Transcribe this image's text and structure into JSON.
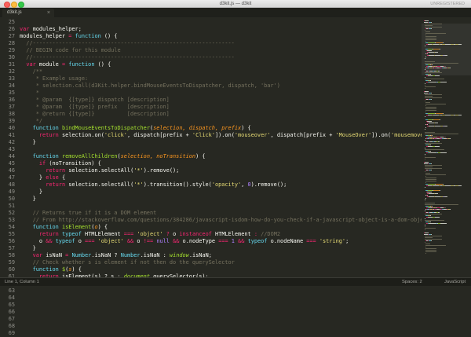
{
  "window": {
    "title": "d3kit.js — d3kit",
    "unregistered": "UNREGISTERED"
  },
  "tabs": [
    {
      "label": "d3kit.js",
      "close": "×"
    }
  ],
  "colors": {
    "background": "#272822",
    "keyword": "#f92672",
    "storage": "#66d9ef",
    "function_name": "#a6e22e",
    "string": "#e6db74",
    "comment": "#75715e",
    "number": "#ae81ff",
    "parameter": "#fd971f"
  },
  "line_numbers": [
    "25",
    "26",
    "27",
    "28",
    "29",
    "30",
    "31",
    "32",
    "33",
    "34",
    "35",
    "36",
    "37",
    "38",
    "39",
    "40",
    "41",
    "42",
    "43",
    "44",
    "45",
    "46",
    "47",
    "48",
    "49",
    "50",
    "51",
    "52",
    "53",
    "54",
    "55",
    "56",
    "57",
    "58",
    "59",
    "60",
    "61",
    "62",
    "63",
    "64",
    "65",
    "66",
    "67",
    "68",
    "69"
  ],
  "code_lines": [
    [],
    [
      [
        "var ",
        "k"
      ],
      [
        "modules_helper;",
        "t"
      ]
    ],
    [
      [
        "modules_helper ",
        "t"
      ],
      [
        "= ",
        "k"
      ],
      [
        "function ",
        "s"
      ],
      [
        "() {",
        "t"
      ]
    ],
    [
      [
        "  //--------------------------------------------------------------",
        "c"
      ]
    ],
    [
      [
        "  // BEGIN code for this module",
        "c"
      ]
    ],
    [
      [
        "  //--------------------------------------------------------------",
        "c"
      ]
    ],
    [
      [
        "  ",
        "t"
      ],
      [
        "var ",
        "k"
      ],
      [
        "module ",
        "t"
      ],
      [
        "= ",
        "k"
      ],
      [
        "function ",
        "s"
      ],
      [
        "() {",
        "t"
      ]
    ],
    [
      [
        "    /**",
        "c"
      ]
    ],
    [
      [
        "     * Example usage:",
        "c"
      ]
    ],
    [
      [
        "     * selection.call(d3Kit.helper.bindMouseEventsToDispatcher, dispatch, 'bar')",
        "c"
      ]
    ],
    [
      [
        "     *",
        "c"
      ]
    ],
    [
      [
        "     * @param  {[type]} dispatch [description]",
        "c"
      ]
    ],
    [
      [
        "     * @param  {[type]} prefix   [description]",
        "c"
      ]
    ],
    [
      [
        "     * @return {[type]}          [description]",
        "c"
      ]
    ],
    [
      [
        "     */",
        "c"
      ]
    ],
    [
      [
        "    ",
        "t"
      ],
      [
        "function ",
        "s"
      ],
      [
        "bindMouseEventsToDispatcher",
        "f"
      ],
      [
        "(",
        "t"
      ],
      [
        "selection, dispatch, prefix",
        "p"
      ],
      [
        ") {",
        "t"
      ]
    ],
    [
      [
        "      ",
        "t"
      ],
      [
        "return ",
        "k"
      ],
      [
        "selection.on(",
        "t"
      ],
      [
        "'click'",
        "q"
      ],
      [
        ", dispatch[prefix + ",
        "t"
      ],
      [
        "'Click'",
        "q"
      ],
      [
        "]).on(",
        "t"
      ],
      [
        "'mouseover'",
        "q"
      ],
      [
        ", dispatch[prefix + ",
        "t"
      ],
      [
        "'MouseOver'",
        "q"
      ],
      [
        "]).on(",
        "t"
      ],
      [
        "'mousemove'",
        "q"
      ],
      [
        ", dispatch[",
        "t"
      ]
    ],
    [
      [
        "    }",
        "t"
      ]
    ],
    [],
    [
      [
        "    ",
        "t"
      ],
      [
        "function ",
        "s"
      ],
      [
        "removeAllChildren",
        "f"
      ],
      [
        "(",
        "t"
      ],
      [
        "selection, noTransition",
        "p"
      ],
      [
        ") {",
        "t"
      ]
    ],
    [
      [
        "      ",
        "t"
      ],
      [
        "if ",
        "k"
      ],
      [
        "(noTransition) {",
        "t"
      ]
    ],
    [
      [
        "        ",
        "t"
      ],
      [
        "return ",
        "k"
      ],
      [
        "selection.selectAll(",
        "t"
      ],
      [
        "'*'",
        "q"
      ],
      [
        ").remove();",
        "t"
      ]
    ],
    [
      [
        "      } ",
        "t"
      ],
      [
        "else ",
        "k"
      ],
      [
        "{",
        "t"
      ]
    ],
    [
      [
        "        ",
        "t"
      ],
      [
        "return ",
        "k"
      ],
      [
        "selection.selectAll(",
        "t"
      ],
      [
        "'*'",
        "q"
      ],
      [
        ").transition().style(",
        "t"
      ],
      [
        "'opacity'",
        "q"
      ],
      [
        ", ",
        "t"
      ],
      [
        "0",
        "n"
      ],
      [
        ").remove();",
        "t"
      ]
    ],
    [
      [
        "      }",
        "t"
      ]
    ],
    [
      [
        "    }",
        "t"
      ]
    ],
    [],
    [
      [
        "    // Returns true if it is a DOM element",
        "c"
      ]
    ],
    [
      [
        "    // From http://stackoverflow.com/questions/384286/javascript-isdom-how-do-you-check-if-a-javascript-object-is-a-dom-object",
        "c"
      ]
    ],
    [
      [
        "    ",
        "t"
      ],
      [
        "function ",
        "s"
      ],
      [
        "isElement",
        "f"
      ],
      [
        "(",
        "t"
      ],
      [
        "o",
        "p"
      ],
      [
        ") {",
        "t"
      ]
    ],
    [
      [
        "      ",
        "t"
      ],
      [
        "return ",
        "k"
      ],
      [
        "typeof ",
        "s"
      ],
      [
        "HTMLElement ",
        "t"
      ],
      [
        "=== ",
        "k"
      ],
      [
        "'object' ",
        "q"
      ],
      [
        "? ",
        "k"
      ],
      [
        "o ",
        "t"
      ],
      [
        "instanceof ",
        "k"
      ],
      [
        "HTMLElement ",
        "t"
      ],
      [
        ": ",
        "k"
      ],
      [
        "//DOM2",
        "c"
      ]
    ],
    [
      [
        "      o ",
        "t"
      ],
      [
        "&& ",
        "k"
      ],
      [
        "typeof ",
        "s"
      ],
      [
        "o ",
        "t"
      ],
      [
        "=== ",
        "k"
      ],
      [
        "'object' ",
        "q"
      ],
      [
        "&& ",
        "k"
      ],
      [
        "o ",
        "t"
      ],
      [
        "!== ",
        "k"
      ],
      [
        "null ",
        "n"
      ],
      [
        "&& ",
        "k"
      ],
      [
        "o.nodeType ",
        "t"
      ],
      [
        "=== ",
        "k"
      ],
      [
        "1 ",
        "n"
      ],
      [
        "&& ",
        "k"
      ],
      [
        "typeof ",
        "s"
      ],
      [
        "o.nodeName ",
        "t"
      ],
      [
        "=== ",
        "k"
      ],
      [
        "'string'",
        "q"
      ],
      [
        ";",
        "t"
      ]
    ],
    [
      [
        "    }",
        "t"
      ]
    ],
    [
      [
        "    ",
        "t"
      ],
      [
        "var ",
        "k"
      ],
      [
        "isNaN ",
        "t"
      ],
      [
        "= ",
        "k"
      ],
      [
        "Number",
        "s"
      ],
      [
        ".isNaN ? ",
        "t"
      ],
      [
        "Number",
        "s"
      ],
      [
        ".isNaN : ",
        "t"
      ],
      [
        "window",
        "o"
      ],
      [
        ".isNaN;",
        "t"
      ]
    ],
    [
      [
        "    // Check whether s is element if not then do the querySelector",
        "c"
      ]
    ],
    [
      [
        "    ",
        "t"
      ],
      [
        "function ",
        "s"
      ],
      [
        "$",
        "f"
      ],
      [
        "(",
        "t"
      ],
      [
        "s",
        "p"
      ],
      [
        ") {",
        "t"
      ]
    ],
    [
      [
        "      ",
        "t"
      ],
      [
        "return ",
        "k"
      ],
      [
        "isElement(s) ? s : ",
        "t"
      ],
      [
        "document",
        "o"
      ],
      [
        ".querySelector(s);",
        "t"
      ]
    ],
    [
      [
        "    }",
        "t"
      ]
    ],
    [
      [
        "    // To get a proper array from a NodeList that matches the CSS selector",
        "c"
      ]
    ],
    [
      [
        "    ",
        "t"
      ],
      [
        "function ",
        "s"
      ],
      [
        "$$",
        "f"
      ],
      [
        "(",
        "t"
      ],
      [
        "s",
        "p"
      ],
      [
        ") {",
        "t"
      ]
    ],
    [
      [
        "      ",
        "t"
      ],
      [
        "return ",
        "k"
      ],
      [
        "Array",
        "s"
      ],
      [
        ".isArray(s) ? s : [].slice.",
        "t"
      ],
      [
        "call",
        "s"
      ],
      [
        "(",
        "t"
      ],
      [
        "document",
        "o"
      ],
      [
        ".querySelectorAll(s));",
        "t"
      ]
    ],
    [
      [
        "    }",
        "t"
      ]
    ],
    [
      [
        "    //",
        "c"
      ]
    ],
    [
      [
        "    // From http://youmightnotneedjquery.com/",
        "c"
      ]
    ],
    [
      [
        "    //",
        "c"
      ]
    ]
  ],
  "status": {
    "position": "Line 1, Column 1",
    "spaces": "Spaces: 2",
    "syntax": "JavaScript"
  }
}
